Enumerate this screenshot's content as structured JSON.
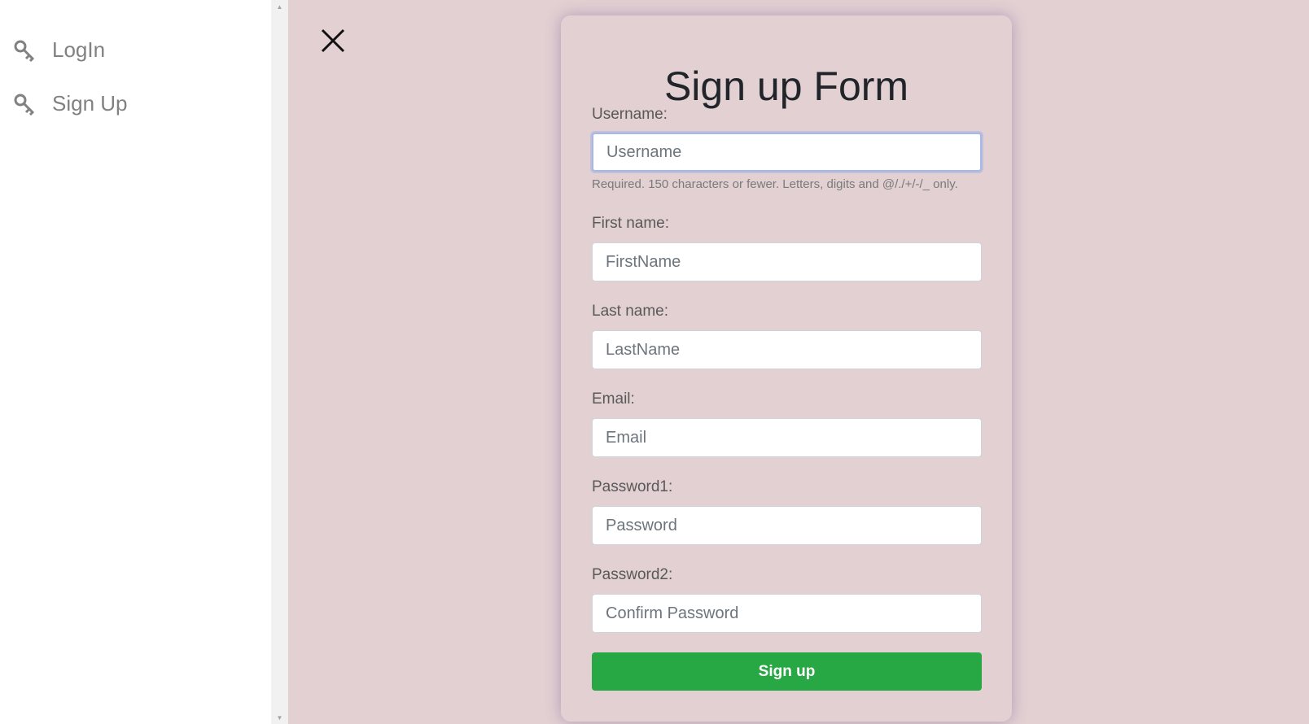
{
  "sidebar": {
    "items": [
      {
        "label": "LogIn",
        "icon": "key-icon"
      },
      {
        "label": "Sign Up",
        "icon": "key-icon"
      }
    ]
  },
  "close": {
    "icon": "close-icon"
  },
  "form": {
    "title": "Sign up Form",
    "username": {
      "label": "Username:",
      "placeholder": "Username",
      "value": "",
      "help": "Required. 150 characters or fewer. Letters, digits and @/./+/-/_ only."
    },
    "first_name": {
      "label": "First name:",
      "placeholder": "FirstName",
      "value": ""
    },
    "last_name": {
      "label": "Last name:",
      "placeholder": "LastName",
      "value": ""
    },
    "email": {
      "label": "Email:",
      "placeholder": "Email",
      "value": ""
    },
    "password1": {
      "label": "Password1:",
      "placeholder": "Password",
      "value": ""
    },
    "password2": {
      "label": "Password2:",
      "placeholder": "Confirm Password",
      "value": ""
    },
    "submit_label": "Sign up"
  },
  "colors": {
    "background": "#e2d0d2",
    "submit": "#28a745",
    "sidebar_text": "#818181"
  }
}
